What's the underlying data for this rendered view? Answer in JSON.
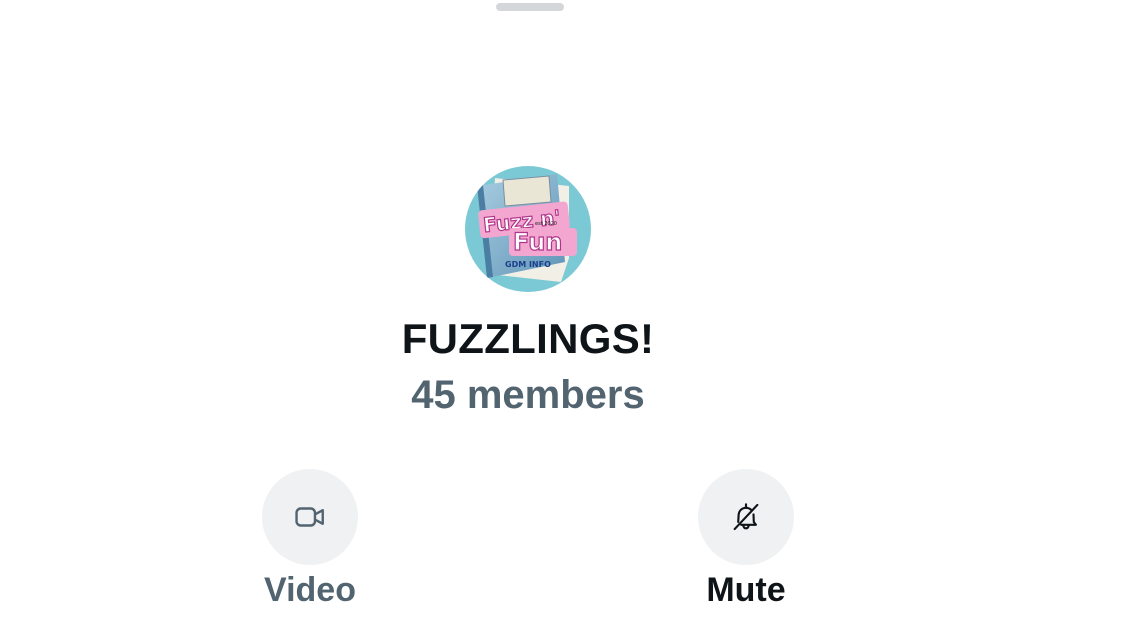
{
  "group": {
    "name": "FUZZLINGS!",
    "member_count": "45 members",
    "avatar": {
      "icon": "group-avatar-image",
      "logo_text": [
        "Fuzz n'",
        "Fun",
        "est 2020",
        "GDM INFO"
      ]
    }
  },
  "actions": {
    "video": {
      "label": "Video",
      "icon": "video-camera-icon"
    },
    "mute": {
      "label": "Mute",
      "icon": "bell-slash-icon"
    }
  },
  "colors": {
    "background": "#ffffff",
    "primary_text": "#0f1419",
    "secondary_text": "#536471",
    "button_bg": "#eff1f3",
    "handle": "#d4d6d9"
  }
}
